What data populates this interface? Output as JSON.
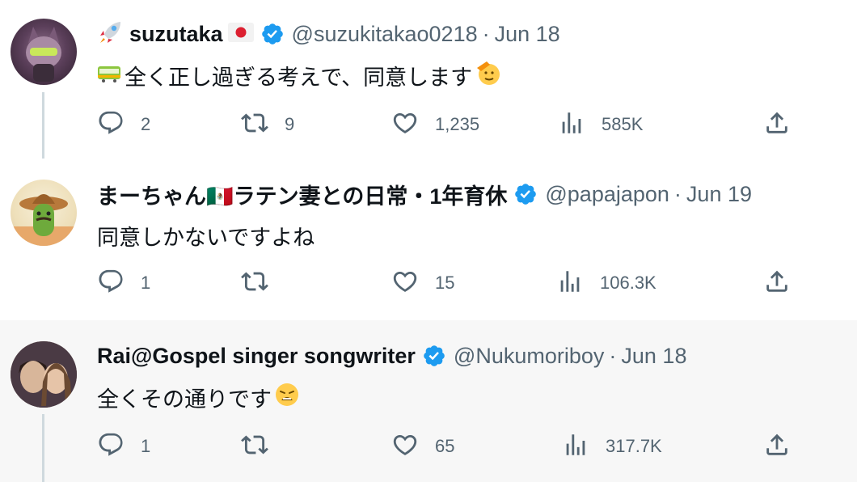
{
  "tweets": [
    {
      "name": "suzutaka",
      "name_prefix_icon": "rocket-emoji",
      "name_suffix_icon": "japan-flag-emoji",
      "handle": "@suzukitakao0218",
      "separator": "·",
      "date": "Jun 18",
      "text": "全く正し過ぎる考えで、同意します",
      "text_prefix_icon": "train-emoji",
      "text_suffix_icon": "saluting-face-emoji",
      "replies": "2",
      "retweets": "9",
      "likes": "1,235",
      "views": "585K"
    },
    {
      "name": "まーちゃん🇲🇽ラテン妻との日常・1年育休",
      "handle": "@papajapon",
      "separator": "·",
      "date": "Jun 19",
      "text": "同意しかないですよね",
      "replies": "1",
      "retweets": "",
      "likes": "15",
      "views": "106.3K"
    },
    {
      "name": "Rai@Gospel singer songwriter",
      "handle": "@Nukumoriboy",
      "separator": "·",
      "date": "Jun 18",
      "text": "全くその通りです",
      "text_suffix_icon": "weary-face-emoji",
      "replies": "1",
      "retweets": "",
      "likes": "65",
      "views": "317.7K"
    }
  ],
  "colors": {
    "text": "#0f1419",
    "muted": "#536471",
    "verified": "#1d9bf0",
    "thread_line": "#cfd9de",
    "highlight_bg": "#f7f7f7"
  }
}
